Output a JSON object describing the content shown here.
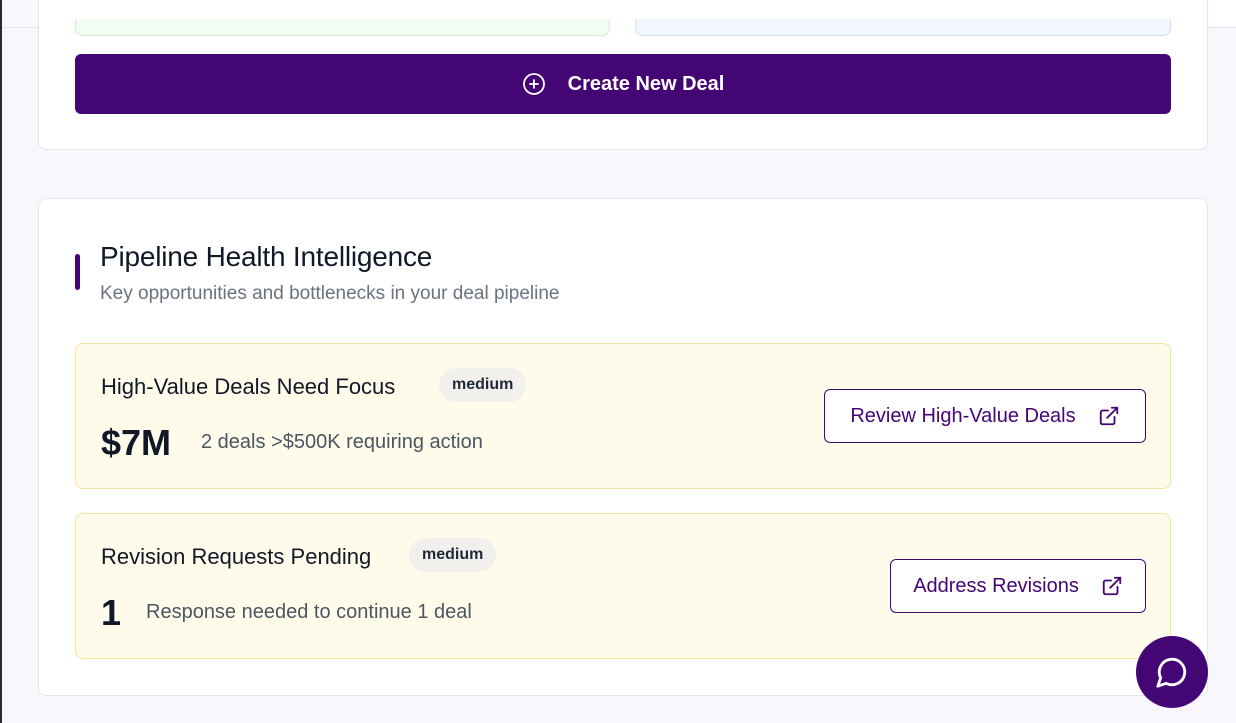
{
  "actions": {
    "create_deal_label": "Create New Deal"
  },
  "pipeline": {
    "title": "Pipeline Health Intelligence",
    "subtitle": "Key opportunities and bottlenecks in your deal pipeline",
    "insights": [
      {
        "title": "High-Value Deals Need Focus",
        "priority": "medium",
        "value": "$7M",
        "description": "2 deals >$500K requiring action",
        "action_label": "Review High-Value Deals",
        "action_icon": "external-link-icon"
      },
      {
        "title": "Revision Requests Pending",
        "priority": "medium",
        "value": "1",
        "description": "Response needed to continue 1 deal",
        "action_label": "Address Revisions",
        "action_icon": "external-link-icon"
      }
    ]
  },
  "icons": {
    "create": "plus-circle-icon",
    "chat": "chat-bubble-icon"
  },
  "colors": {
    "brand": "#440575",
    "insight_bg": "#fefbea",
    "insight_border": "#f3e6a0"
  }
}
